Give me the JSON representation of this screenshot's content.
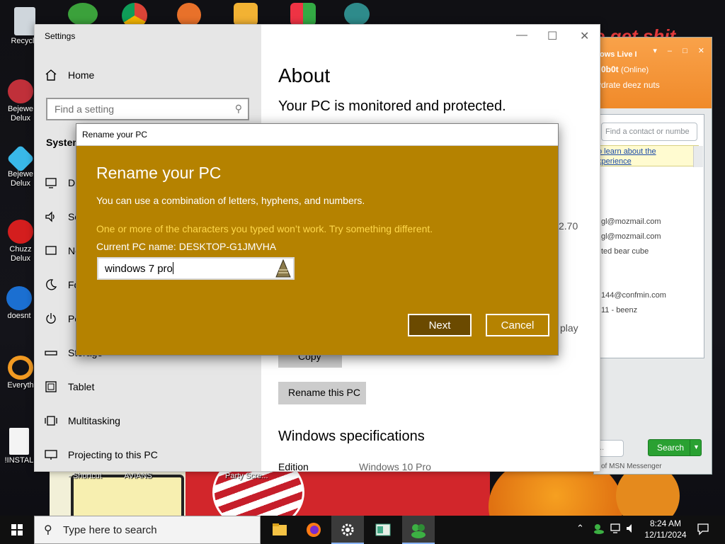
{
  "desktop": {
    "icons": [
      {
        "label": "Recycle"
      },
      {
        "label": "Bejewe\nDelux"
      },
      {
        "label": "Bejewe\nDelux"
      },
      {
        "label": "Chuzz\nDelux"
      },
      {
        "label": "doesnt"
      },
      {
        "label": "Everyth"
      },
      {
        "label": "!INSTAL"
      }
    ],
    "bottom_labels": [
      "- Shortcut",
      "AVIANS",
      "Party Scre..."
    ],
    "banner_text": "e get shit"
  },
  "msn": {
    "title": "ows Live I",
    "nick": "0b0t",
    "online": "(Online)",
    "status": "ydrate deez nuts",
    "search_placeholder": "Find a contact or numbe",
    "ad_line1": "o learn about the",
    "ad_line2": "xperience",
    "contacts": [
      "gl@mozmail.com",
      "gl@mozmail.com",
      "ted bear cube",
      "144@confmin.com",
      "11 - beenz"
    ],
    "search_button": "Search",
    "footer": "of MSN Messenger",
    "bottom_input": "..."
  },
  "settings": {
    "window_title": "Settings",
    "home": "Home",
    "search_placeholder": "Find a setting",
    "section": "System",
    "nav": [
      {
        "label": "Di"
      },
      {
        "label": "So"
      },
      {
        "label": "No"
      },
      {
        "label": "Fo"
      },
      {
        "label": "Po"
      },
      {
        "label": "Storage"
      },
      {
        "label": "Tablet"
      },
      {
        "label": "Multitasking"
      },
      {
        "label": "Projecting to this PC"
      }
    ],
    "page_title": "About",
    "protection": "Your PC is monitored and protected.",
    "partial_version": "2.70",
    "partial_display": "play",
    "copy_button": "Copy",
    "rename_button": "Rename this PC",
    "spec_title": "Windows specifications",
    "edition_label": "Edition",
    "edition_value": "Windows 10 Pro"
  },
  "dialog": {
    "title": "Rename your PC",
    "heading": "Rename your PC",
    "description": "You can use a combination of letters, hyphens, and numbers.",
    "warning": "One or more of the characters you typed won’t work. Try something different.",
    "current_name": "Current PC name: DESKTOP-G1JMVHA",
    "input_value": "windows 7 pro",
    "next": "Next",
    "cancel": "Cancel"
  },
  "taskbar": {
    "search_placeholder": "Type here to search",
    "time": "8:24 AM",
    "date": "12/11/2024"
  },
  "colors": {
    "accent": "#b58200",
    "accent_dark": "#6b4a00",
    "warning": "#ffd84a",
    "msn_orange": "#f08a2a"
  }
}
